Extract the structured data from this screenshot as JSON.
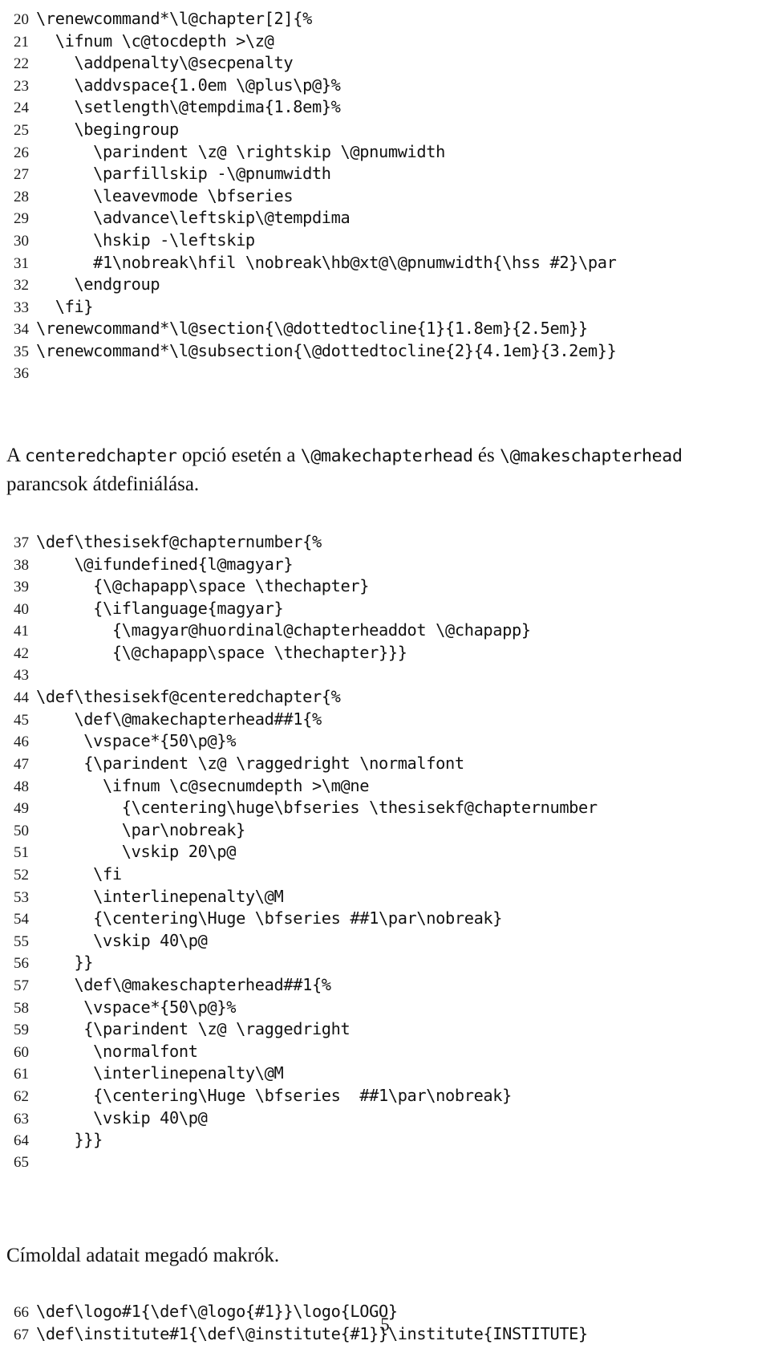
{
  "document": {
    "page_number": "5",
    "language": "hu"
  },
  "listing_one": [
    {
      "n": "20",
      "code": "\\renewcommand*\\l@chapter[2]{%"
    },
    {
      "n": "21",
      "code": "  \\ifnum \\c@tocdepth >\\z@"
    },
    {
      "n": "22",
      "code": "    \\addpenalty\\@secpenalty"
    },
    {
      "n": "23",
      "code": "    \\addvspace{1.0em \\@plus\\p@}%"
    },
    {
      "n": "24",
      "code": "    \\setlength\\@tempdima{1.8em}%"
    },
    {
      "n": "25",
      "code": "    \\begingroup"
    },
    {
      "n": "26",
      "code": "      \\parindent \\z@ \\rightskip \\@pnumwidth"
    },
    {
      "n": "27",
      "code": "      \\parfillskip -\\@pnumwidth"
    },
    {
      "n": "28",
      "code": "      \\leavevmode \\bfseries"
    },
    {
      "n": "29",
      "code": "      \\advance\\leftskip\\@tempdima"
    },
    {
      "n": "30",
      "code": "      \\hskip -\\leftskip"
    },
    {
      "n": "31",
      "code": "      #1\\nobreak\\hfil \\nobreak\\hb@xt@\\@pnumwidth{\\hss #2}\\par"
    },
    {
      "n": "32",
      "code": "    \\endgroup"
    },
    {
      "n": "33",
      "code": "  \\fi}"
    },
    {
      "n": "34",
      "code": "\\renewcommand*\\l@section{\\@dottedtocline{1}{1.8em}{2.5em}}"
    },
    {
      "n": "35",
      "code": "\\renewcommand*\\l@subsection{\\@dottedtocline{2}{4.1em}{3.2em}}"
    },
    {
      "n": "36",
      "code": ""
    }
  ],
  "prose_one": {
    "segments": [
      {
        "text": "A ",
        "style": "roman"
      },
      {
        "text": "centeredchapter",
        "style": "mono"
      },
      {
        "text": " opció esetén a ",
        "style": "roman"
      },
      {
        "text": "\\@makechapterhead",
        "style": "mono"
      },
      {
        "text": " és ",
        "style": "roman"
      },
      {
        "text": "\\@makeschapterhead",
        "style": "mono"
      },
      {
        "text": " parancsok átdefiniálása.",
        "style": "roman"
      }
    ],
    "plain": "A centeredchapter opció esetén a \\@makechapterhead és \\@makeschapterhead parancsok átdefiniálása."
  },
  "listing_two": [
    {
      "n": "37",
      "code": "\\def\\thesisekf@chapternumber{%"
    },
    {
      "n": "38",
      "code": "    \\@ifundefined{l@magyar}"
    },
    {
      "n": "39",
      "code": "      {\\@chapapp\\space \\thechapter}"
    },
    {
      "n": "40",
      "code": "      {\\iflanguage{magyar}"
    },
    {
      "n": "41",
      "code": "        {\\magyar@huordinal@chapterheaddot \\@chapapp}"
    },
    {
      "n": "42",
      "code": "        {\\@chapapp\\space \\thechapter}}}"
    },
    {
      "n": "43",
      "code": ""
    },
    {
      "n": "44",
      "code": "\\def\\thesisekf@centeredchapter{%"
    },
    {
      "n": "45",
      "code": "    \\def\\@makechapterhead##1{%"
    },
    {
      "n": "46",
      "code": "     \\vspace*{50\\p@}%"
    },
    {
      "n": "47",
      "code": "     {\\parindent \\z@ \\raggedright \\normalfont"
    },
    {
      "n": "48",
      "code": "       \\ifnum \\c@secnumdepth >\\m@ne"
    },
    {
      "n": "49",
      "code": "         {\\centering\\huge\\bfseries \\thesisekf@chapternumber"
    },
    {
      "n": "50",
      "code": "         \\par\\nobreak}"
    },
    {
      "n": "51",
      "code": "         \\vskip 20\\p@"
    },
    {
      "n": "52",
      "code": "      \\fi"
    },
    {
      "n": "53",
      "code": "      \\interlinepenalty\\@M"
    },
    {
      "n": "54",
      "code": "      {\\centering\\Huge \\bfseries ##1\\par\\nobreak}"
    },
    {
      "n": "55",
      "code": "      \\vskip 40\\p@"
    },
    {
      "n": "56",
      "code": "    }}"
    },
    {
      "n": "57",
      "code": "    \\def\\@makeschapterhead##1{%"
    },
    {
      "n": "58",
      "code": "     \\vspace*{50\\p@}%"
    },
    {
      "n": "59",
      "code": "     {\\parindent \\z@ \\raggedright"
    },
    {
      "n": "60",
      "code": "      \\normalfont"
    },
    {
      "n": "61",
      "code": "      \\interlinepenalty\\@M"
    },
    {
      "n": "62",
      "code": "      {\\centering\\Huge \\bfseries  ##1\\par\\nobreak}"
    },
    {
      "n": "63",
      "code": "      \\vskip 40\\p@"
    },
    {
      "n": "64",
      "code": "    }}}"
    },
    {
      "n": "65",
      "code": ""
    }
  ],
  "prose_two": {
    "plain": "Címoldal adatait megadó makrók."
  },
  "listing_three": [
    {
      "n": "66",
      "code": "\\def\\logo#1{\\def\\@logo{#1}}\\logo{LOGO}"
    },
    {
      "n": "67",
      "code": "\\def\\institute#1{\\def\\@institute{#1}}\\institute{INSTITUTE}"
    }
  ]
}
